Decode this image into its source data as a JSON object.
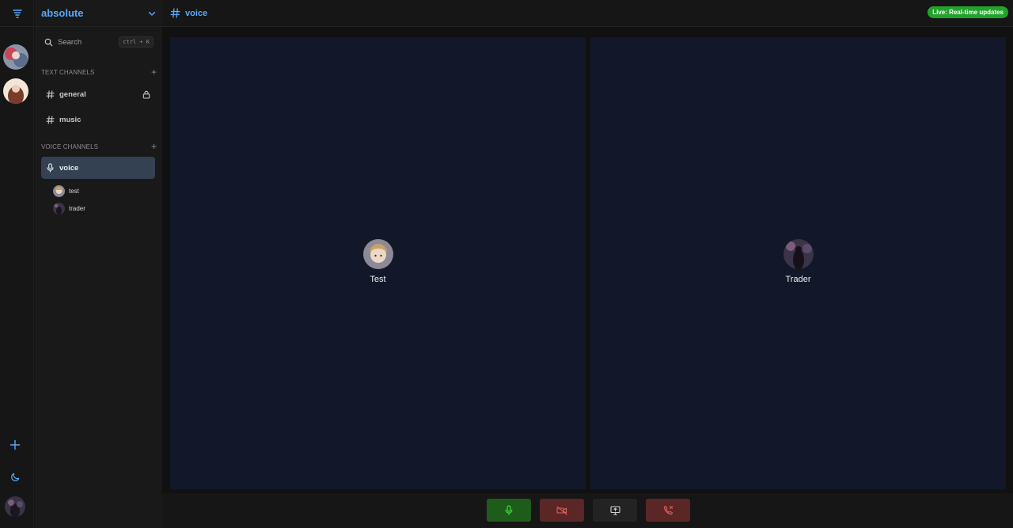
{
  "server": {
    "name": "absolute"
  },
  "search": {
    "label": "Search",
    "shortcut": "ctrl + K"
  },
  "sections": {
    "text": "TEXT CHANNELS",
    "voice": "VOICE CHANNELS"
  },
  "text_channels": [
    {
      "name": "general",
      "locked": true
    },
    {
      "name": "music",
      "locked": false
    }
  ],
  "voice_channels": [
    {
      "name": "voice",
      "active": true,
      "members": [
        "test",
        "trader"
      ]
    }
  ],
  "header": {
    "channel": "voice",
    "live_badge": "Live: Real-time updates"
  },
  "participants": [
    {
      "name": "Test"
    },
    {
      "name": "Trader"
    }
  ],
  "colors": {
    "accent": "#5aa9ff",
    "live": "#22a32a",
    "tile_bg": "#121829",
    "mic_on": "#1f5b1b",
    "danger": "#5a2626",
    "active_channel": "#334152"
  },
  "icons": {
    "rail_top": "filter-list-icon",
    "add_server": "plus-icon",
    "theme": "moon-icon",
    "mic": "microphone-icon",
    "camera_off": "camera-off-icon",
    "screen_share": "screen-share-icon",
    "hangup": "phone-hangup-icon"
  }
}
